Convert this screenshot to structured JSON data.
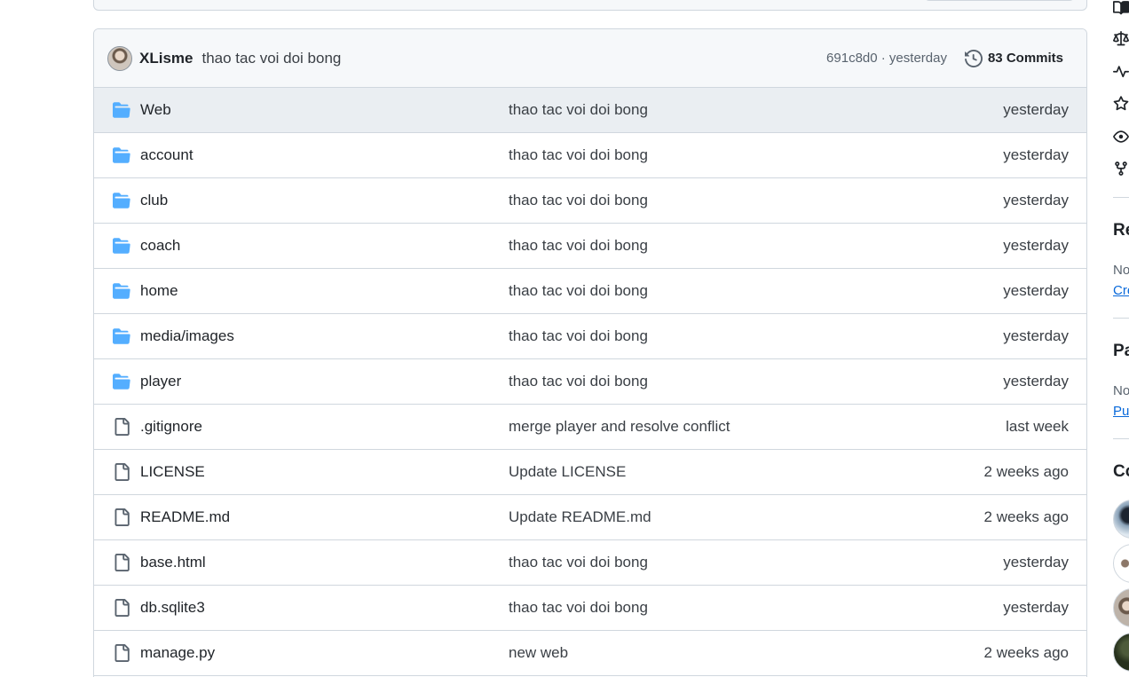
{
  "latest_commit": {
    "author": "XLisme",
    "message": "thao tac voi doi bong",
    "meta": "691c8d0 · yesterday",
    "commits_label": "83 Commits"
  },
  "files": [
    {
      "type": "folder",
      "name": "Web",
      "message": "thao tac voi doi bong",
      "age": "yesterday"
    },
    {
      "type": "folder",
      "name": "account",
      "message": "thao tac voi doi bong",
      "age": "yesterday"
    },
    {
      "type": "folder",
      "name": "club",
      "message": "thao tac voi doi bong",
      "age": "yesterday"
    },
    {
      "type": "folder",
      "name": "coach",
      "message": "thao tac voi doi bong",
      "age": "yesterday"
    },
    {
      "type": "folder",
      "name": "home",
      "message": "thao tac voi doi bong",
      "age": "yesterday"
    },
    {
      "type": "folder",
      "name": "media/images",
      "message": "thao tac voi doi bong",
      "age": "yesterday"
    },
    {
      "type": "folder",
      "name": "player",
      "message": "thao tac voi doi bong",
      "age": "yesterday"
    },
    {
      "type": "file",
      "name": ".gitignore",
      "message": "merge player and resolve conflict",
      "age": "last week"
    },
    {
      "type": "file",
      "name": "LICENSE",
      "message": "Update LICENSE",
      "age": "2 weeks ago"
    },
    {
      "type": "file",
      "name": "README.md",
      "message": "Update README.md",
      "age": "2 weeks ago"
    },
    {
      "type": "file",
      "name": "base.html",
      "message": "thao tac voi doi bong",
      "age": "yesterday"
    },
    {
      "type": "file",
      "name": "db.sqlite3",
      "message": "thao tac voi doi bong",
      "age": "yesterday"
    },
    {
      "type": "file",
      "name": "manage.py",
      "message": "new web",
      "age": "2 weeks ago"
    }
  ],
  "sidebar": {
    "icons": [
      "book-icon",
      "law-icon",
      "pulse-icon",
      "star-icon",
      "eye-icon",
      "repo-forked-icon"
    ],
    "releases_heading": "Re",
    "releases_text": "No",
    "releases_link": "Cre",
    "packages_heading": "Pa",
    "packages_text": "No",
    "packages_link": "Pu",
    "contributors_heading": "Co"
  },
  "colors": {
    "folder": "#54aeff",
    "border": "#d0d7de",
    "header_bg": "#f6f8fa",
    "link": "#0969da"
  }
}
